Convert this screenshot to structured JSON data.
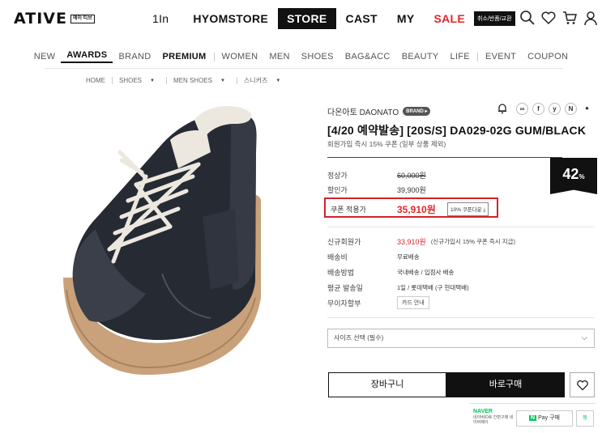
{
  "header": {
    "logo_text": "ATIVE",
    "logo_box": "에이 티브",
    "nav": [
      "1In",
      "HYOMSTORE",
      "STORE",
      "CAST",
      "MY",
      "SALE"
    ],
    "util_badge": "취소/반품/교환",
    "icons": [
      "search-icon",
      "heart-icon",
      "cart-icon",
      "user-icon"
    ]
  },
  "subnav": {
    "group1": [
      "NEW",
      "AWARDS",
      "BRAND",
      "PREMIUM"
    ],
    "group2": [
      "WOMEN",
      "MEN",
      "SHOES",
      "BAG&ACC",
      "BEAUTY",
      "LIFE"
    ],
    "group3": [
      "EVENT",
      "COUPON"
    ]
  },
  "breadcrumb": [
    "HOME",
    "SHOES",
    "MEN SHOES",
    "스니커즈"
  ],
  "product": {
    "brand": "다온아토 DAONATO",
    "brand_badge": "BRAND",
    "title": "[4/20 예약발송] [20S/S] DA029-02G GUM/BLACK",
    "subtitle": "회원가입 즉시 15% 쿠폰 (일부 상품 제외)",
    "discount_percent": "42",
    "discount_unit": "%",
    "regular_price_label": "정상가",
    "regular_price": "60,000원",
    "sale_price_label": "할인가",
    "sale_price": "39,900원",
    "coupon_label": "쿠폰 적용가",
    "coupon_price": "35,910원",
    "coupon_button": "10% 쿠폰다운",
    "new_member_label": "신규회원가",
    "new_member_price": "33,910원",
    "new_member_note": "(신규가입시 15% 쿠폰 즉시 지급)",
    "shipping_fee_label": "배송비",
    "shipping_fee": "무료배송",
    "shipping_method_label": "배송방법",
    "shipping_method": "국내배송 / 입점사 배송",
    "avg_ship_label": "평균 발송일",
    "avg_ship": "1일 / 롯데택배 (구 현대택배)",
    "installment_label": "무이자할부",
    "installment_button": "카드 안내",
    "size_select_placeholder": "사이즈 선택 (필수)",
    "cart_button": "장바구니",
    "buy_button": "바로구매"
  },
  "naver": {
    "logo": "NAVER",
    "desc": "네이버ID로 간편구매 네이버페이",
    "pay_button": "Pay 구매",
    "wish_button": "찜"
  }
}
